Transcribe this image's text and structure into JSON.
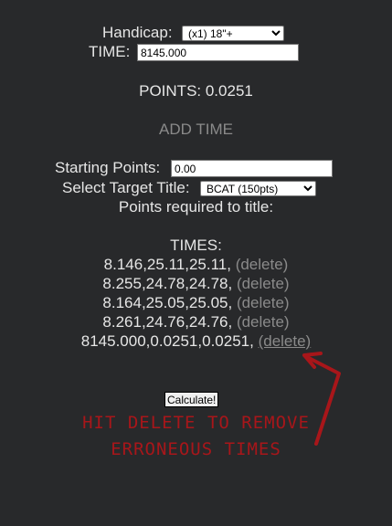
{
  "form": {
    "handicap_label": "Handicap:",
    "handicap_value": "(x1) 18\"+",
    "time_label": "TIME:",
    "time_value": "8145.000",
    "points_text": "POINTS: 0.0251",
    "add_time_label": "ADD TIME"
  },
  "title_section": {
    "starting_points_label": "Starting Points:",
    "starting_points_value": "0.00",
    "target_title_label": "Select Target Title:",
    "target_title_value": "BCAT (150pts)",
    "points_required_label": "Points required to title:"
  },
  "times": {
    "header": "TIMES:",
    "delete_label": "(delete)",
    "entries": [
      {
        "text": "8.146,25.11,25.11,"
      },
      {
        "text": "8.255,24.78,24.78,"
      },
      {
        "text": "8.164,25.05,25.05,"
      },
      {
        "text": "8.261,24.76,24.76,"
      },
      {
        "text": "8145.000,0.0251,0.0251,"
      }
    ]
  },
  "calculate_label": "Calculate!",
  "annotation": {
    "line1": "HIT DELETE TO REMOVE",
    "line2": "ERRONEOUS TIMES",
    "color": "#a8161a"
  },
  "colors": {
    "background": "#28292b",
    "text": "#e6e6e6",
    "muted": "#8a8a8a"
  }
}
